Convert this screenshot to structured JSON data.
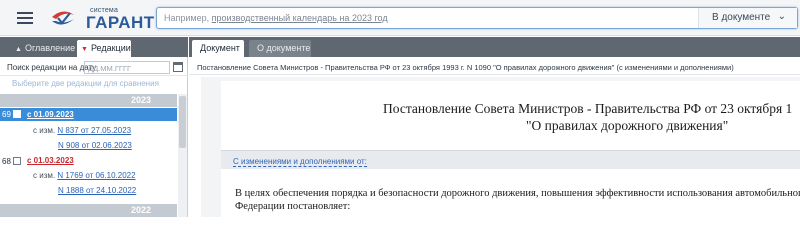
{
  "header": {
    "logo_small": "система",
    "logo_big": "ГАРАНТ",
    "search_placeholder_prefix": "Например, ",
    "search_placeholder_link": "производственный календарь на 2023 год",
    "search_scope": "В документе"
  },
  "left_panel": {
    "tabs": [
      {
        "label": "Оглавление"
      },
      {
        "label": "Редакции"
      }
    ],
    "date_label": "Поиск редакции на дату",
    "date_placeholder": "ДД.ММ.ГГГГ",
    "compare_hint": "Выберите две редакции для сравнения",
    "years": [
      "2023",
      "2022"
    ],
    "revisions": [
      {
        "num": "69",
        "label": "с 01.09.2023",
        "changes_label": "с изм.",
        "changes": [
          "N 837 от 27.05.2023",
          "N 908 от 02.06.2023"
        ]
      },
      {
        "num": "68",
        "label": "с 01.03.2023",
        "changes_label": "с изм.",
        "changes": [
          "N 1769 от 06.10.2022",
          "N 1888 от 24.10.2022"
        ]
      }
    ]
  },
  "right_panel": {
    "tabs": [
      {
        "label": "Документ"
      },
      {
        "label": "О документе"
      }
    ],
    "breadcrumb": "Постановление Совета Министров - Правительства РФ от 23 октября 1993 г. N 1090 \"О правилах дорожного движения\" (с изменениями и дополнениями)",
    "doc_title_line1": "Постановление Совета Министров - Правительства РФ от 23 октября 1",
    "doc_title_line2": "\"О правилах дорожного движения\"",
    "changes_link": "С изменениями и дополнениями от:",
    "body_line1": "В целях обеспечения порядка и безопасности дорожного движения, повышения эффективности использования автомобильного тра",
    "body_line2": "Федерации постановляет:"
  },
  "colors": {
    "accent": "#3a8cd9",
    "tab_bar": "#5f6771",
    "revision_red": "#c8282b",
    "link_blue": "#2a64b6"
  }
}
